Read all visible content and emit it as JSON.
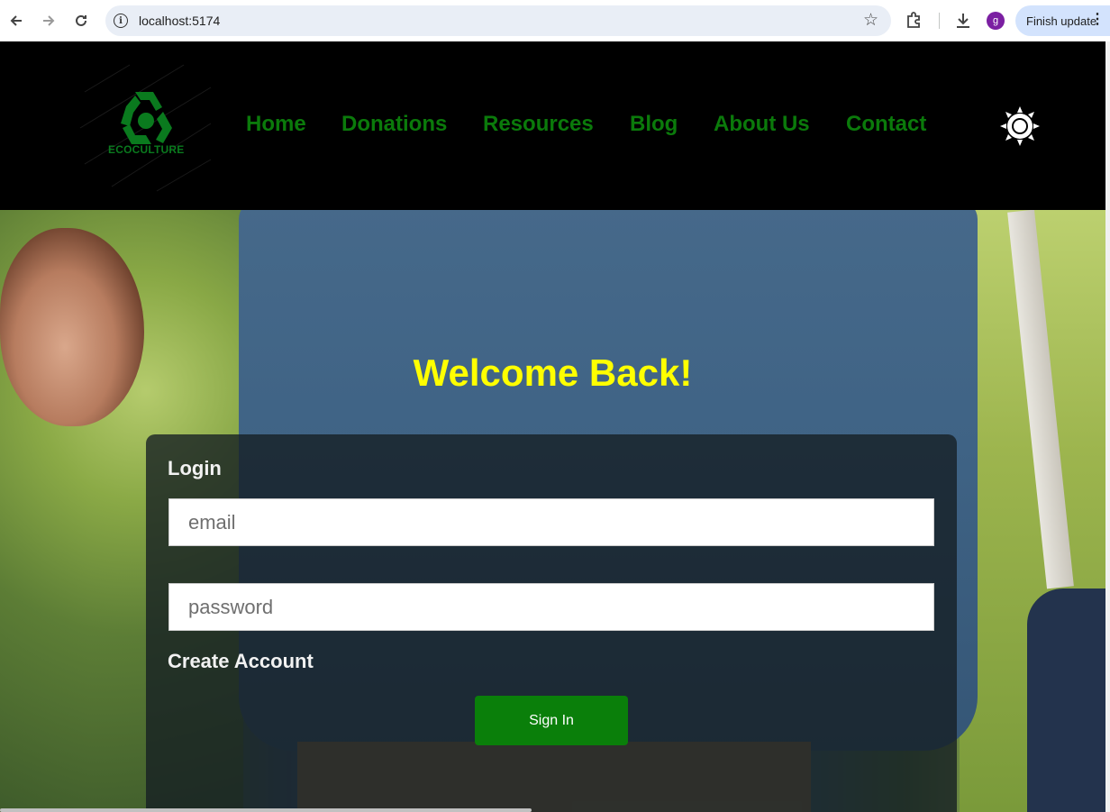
{
  "browser": {
    "url": "localhost:5174",
    "profile_initial": "g",
    "update_label": "Finish update"
  },
  "site": {
    "logo_text": "ECOCULTURE",
    "nav": [
      "Home",
      "Donations",
      "Resources",
      "Blog",
      "About Us",
      "Contact"
    ],
    "colors": {
      "nav": "#0b7a0b",
      "welcome": "#ffff00",
      "button": "#0a7f0a"
    }
  },
  "hero": {
    "welcome": "Welcome Back!"
  },
  "login": {
    "title": "Login",
    "email_placeholder": "email",
    "password_placeholder": "password",
    "create_account": "Create Account",
    "sign_in": "Sign In"
  }
}
